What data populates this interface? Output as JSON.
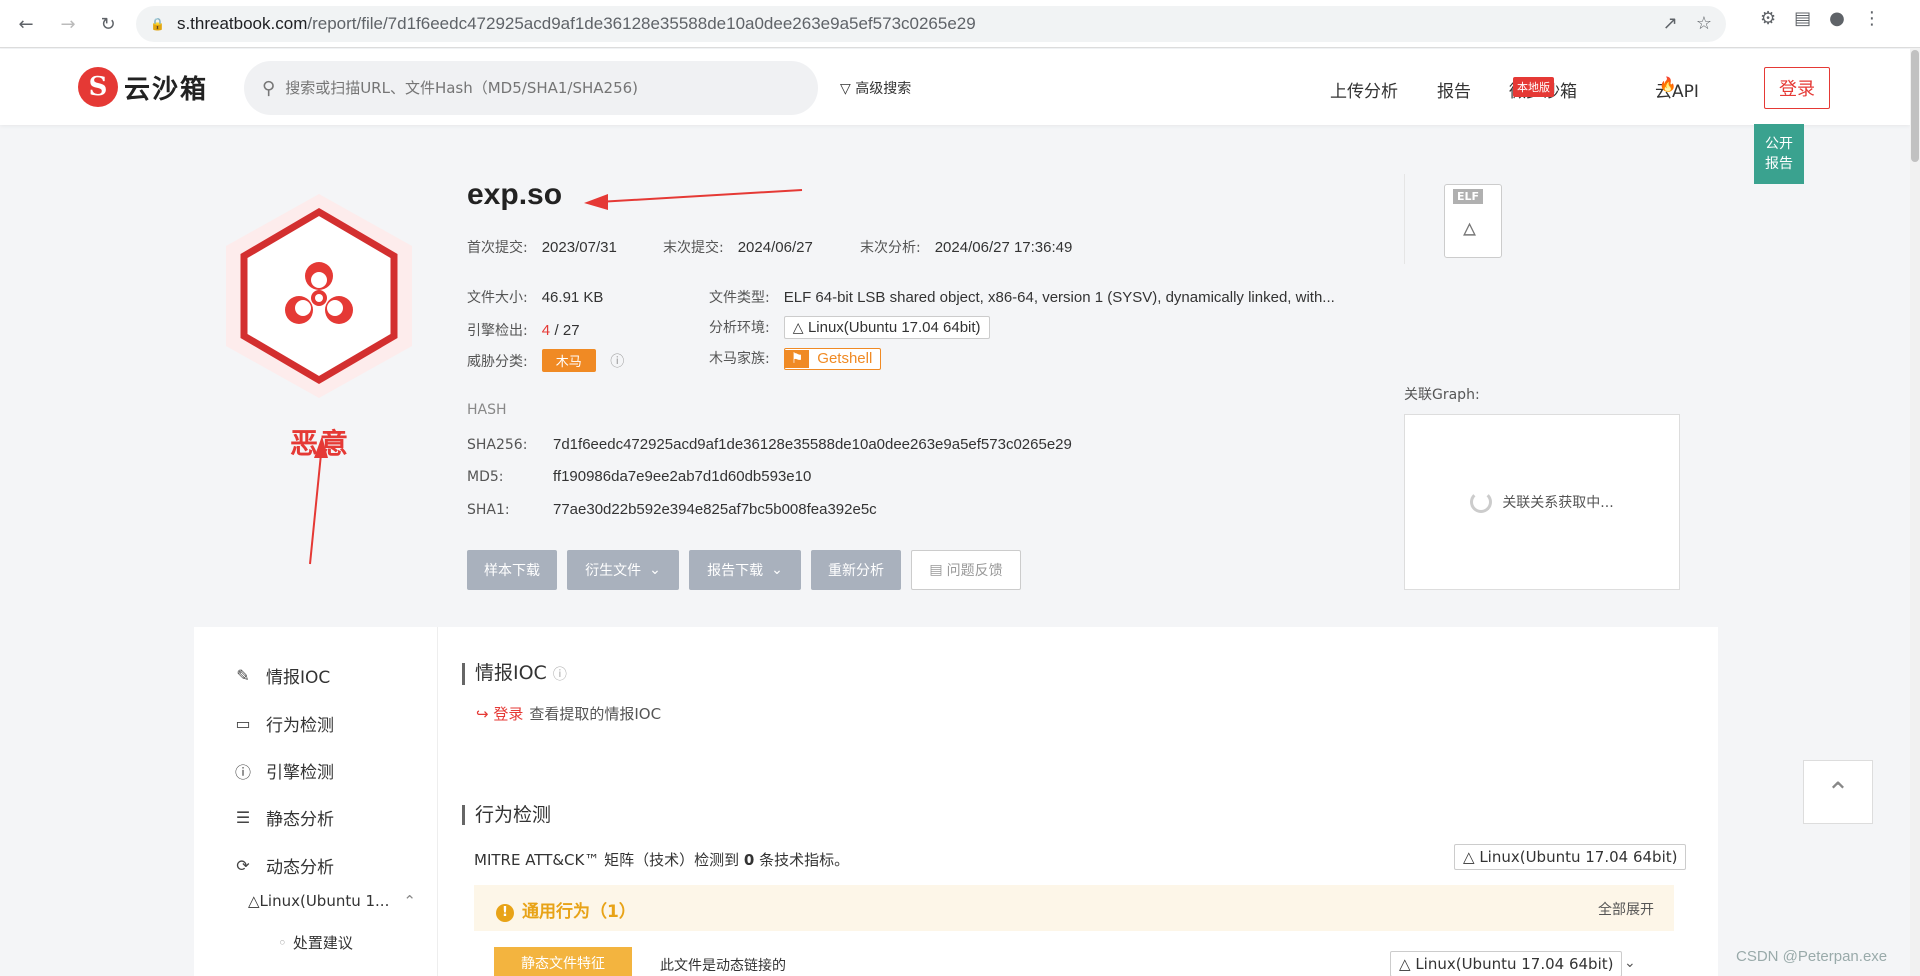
{
  "browser": {
    "url_host": "s.threatbook.com",
    "url_path": "/report/file/7d1f6eedc472925acd9af1de36128e35588de10a0dee263e9a5ef573c0265e29"
  },
  "header": {
    "logo_text": "云沙箱",
    "search_placeholder": "搜索或扫描URL、文件Hash（MD5/SHA1/SHA256)",
    "advanced_search": "高级搜索",
    "nav": [
      "上传分析",
      "报告",
      "微步沙箱",
      "云API"
    ],
    "local_badge": "本地版",
    "login": "登录"
  },
  "public_report": [
    "公开",
    "报告"
  ],
  "verdict": {
    "label": "恶意",
    "color": "#e53935"
  },
  "file": {
    "name": "exp.so",
    "first_submit_label": "首次提交:",
    "first_submit": "2023/07/31",
    "last_submit_label": "末次提交:",
    "last_submit": "2024/06/27",
    "last_analysis_label": "末次分析:",
    "last_analysis": "2024/06/27 17:36:49",
    "size_label": "文件大小:",
    "size": "46.91 KB",
    "type_label": "文件类型:",
    "type": "ELF 64-bit LSB shared object, x86-64, version 1 (SYSV), dynamically linked, with...",
    "engine_label": "引擎检出:",
    "engine_hits": "4",
    "engine_total": "/ 27",
    "env_label": "分析环境:",
    "env": "Linux(Ubuntu 17.04 64bit)",
    "threat_label": "威胁分类:",
    "threat": "木马",
    "family_label": "木马家族:",
    "family": "Getshell"
  },
  "hash": {
    "title": "HASH",
    "sha256_label": "SHA256:",
    "sha256": "7d1f6eedc472925acd9af1de36128e35588de10a0dee263e9a5ef573c0265e29",
    "md5_label": "MD5:",
    "md5": "ff190986da7e9ee2ab7d1d60db593e10",
    "sha1_label": "SHA1:",
    "sha1": "77ae30d22b592e394e825af7bc5b008fea392e5c"
  },
  "actions": {
    "sample_download": "样本下载",
    "derived_files": "衍生文件",
    "report_download": "报告下载",
    "reanalyze": "重新分析",
    "feedback": "问题反馈"
  },
  "filetype_badge": "ELF",
  "graph": {
    "label": "关联Graph:",
    "loading": "关联关系获取中..."
  },
  "sidebar": {
    "items": [
      "情报IOC",
      "行为检测",
      "引擎检测",
      "静态分析",
      "动态分析"
    ],
    "sub_env": "Linux(Ubuntu 1...",
    "sub_items": [
      "处置建议"
    ]
  },
  "sections": {
    "ioc_title": "情报IOC",
    "ioc_login": "登录",
    "ioc_text": "查看提取的情报IOC",
    "behavior_title": "行为检测",
    "mitre_text_pre": "MITRE ATT&CK™ 矩阵（技术）检测到",
    "mitre_count": "0",
    "mitre_text_post": "条技术指标。",
    "env_chip": "Linux(Ubuntu 17.04 64bit)",
    "general_title": "通用行为（1）",
    "expand_all": "全部展开",
    "static_tag": "静态文件特征",
    "dynamic_link": "此文件是动态链接的",
    "env_chip2": "Linux(Ubuntu 17.04 64bit)"
  },
  "watermark": "CSDN @Peterpan.exe"
}
